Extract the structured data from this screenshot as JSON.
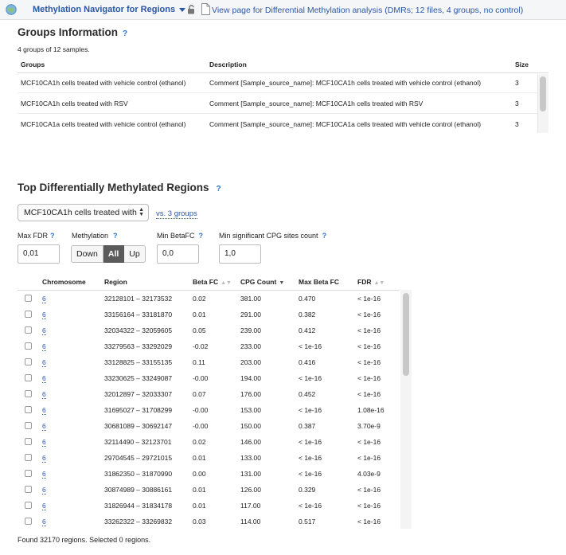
{
  "topbar": {
    "logo_icon": "globe-logo-icon",
    "app_title": "Methylation Navigator for Regions",
    "lock_icon": "lock-icon",
    "doc_icon": "document-icon",
    "view_link": "View page for Differential Methylation analysis (DMRs; 12 files, 4 groups, no control)"
  },
  "groups": {
    "title": "Groups Information",
    "help": "?",
    "count_text": "4 groups of 12 samples.",
    "columns": [
      "Groups",
      "Description",
      "Size"
    ],
    "rows": [
      {
        "group": "MCF10CA1h cells treated with vehicle control (ethanol)",
        "description": "Comment [Sample_source_name]: MCF10CA1h cells treated with vehicle control (ethanol)",
        "size": "3"
      },
      {
        "group": "MCF10CA1h cells treated with RSV",
        "description": "Comment [Sample_source_name]: MCF10CA1h cells treated with RSV",
        "size": "3"
      },
      {
        "group": "MCF10CA1a cells treated with vehicle control (ethanol)",
        "description": "Comment [Sample_source_name]: MCF10CA1a cells treated with vehicle control (ethanol)",
        "size": "3"
      }
    ]
  },
  "dmr": {
    "title": "Top Differentially Methylated Regions",
    "help": "?",
    "group_select": "MCF10CA1h cells treated with",
    "vs_link": "vs. 3 groups",
    "filters": {
      "max_fdr_label": "Max FDR",
      "max_fdr_value": "0,01",
      "methylation_label": "Methylation",
      "methylation_options": [
        "Down",
        "All",
        "Up"
      ],
      "methylation_selected": "All",
      "min_betafc_label": "Min BetaFC",
      "min_betafc_value": "0,0",
      "min_cpg_label": "Min significant CPG sites count",
      "min_cpg_value": "1,0"
    },
    "columns": [
      "Chromosome",
      "Region",
      "Beta FC",
      "CPG Count",
      "Max Beta FC",
      "FDR"
    ],
    "sorted_column": "CPG Count",
    "rows": [
      {
        "chrom": "6",
        "region": "32128101 – 32173532",
        "beta_fc": "0.02",
        "cpg": "381.00",
        "max_beta": "0.470",
        "fdr": "< 1e-16"
      },
      {
        "chrom": "6",
        "region": "33156164 – 33181870",
        "beta_fc": "0.01",
        "cpg": "291.00",
        "max_beta": "0.382",
        "fdr": "< 1e-16"
      },
      {
        "chrom": "6",
        "region": "32034322 – 32059605",
        "beta_fc": "0.05",
        "cpg": "239.00",
        "max_beta": "0.412",
        "fdr": "< 1e-16"
      },
      {
        "chrom": "6",
        "region": "33279563 – 33292029",
        "beta_fc": "-0.02",
        "cpg": "233.00",
        "max_beta": "< 1e-16",
        "fdr": "< 1e-16"
      },
      {
        "chrom": "6",
        "region": "33128825 – 33155135",
        "beta_fc": "0.11",
        "cpg": "203.00",
        "max_beta": "0.416",
        "fdr": "< 1e-16"
      },
      {
        "chrom": "6",
        "region": "33230625 – 33249087",
        "beta_fc": "-0.00",
        "cpg": "194.00",
        "max_beta": "< 1e-16",
        "fdr": "< 1e-16"
      },
      {
        "chrom": "6",
        "region": "32012897 – 32033307",
        "beta_fc": "0.07",
        "cpg": "176.00",
        "max_beta": "0.452",
        "fdr": "< 1e-16"
      },
      {
        "chrom": "6",
        "region": "31695027 – 31708299",
        "beta_fc": "-0.00",
        "cpg": "153.00",
        "max_beta": "< 1e-16",
        "fdr": "1.08e-16"
      },
      {
        "chrom": "6",
        "region": "30681089 – 30692147",
        "beta_fc": "-0.00",
        "cpg": "150.00",
        "max_beta": "0.387",
        "fdr": "3.70e-9"
      },
      {
        "chrom": "6",
        "region": "32114490 – 32123701",
        "beta_fc": "0.02",
        "cpg": "146.00",
        "max_beta": "< 1e-16",
        "fdr": "< 1e-16"
      },
      {
        "chrom": "6",
        "region": "29704545 – 29721015",
        "beta_fc": "0.01",
        "cpg": "133.00",
        "max_beta": "< 1e-16",
        "fdr": "< 1e-16"
      },
      {
        "chrom": "6",
        "region": "31862350 – 31870990",
        "beta_fc": "0.00",
        "cpg": "131.00",
        "max_beta": "< 1e-16",
        "fdr": "4.03e-9"
      },
      {
        "chrom": "6",
        "region": "30874989 – 30886161",
        "beta_fc": "0.01",
        "cpg": "126.00",
        "max_beta": "0.329",
        "fdr": "< 1e-16"
      },
      {
        "chrom": "6",
        "region": "31826944 – 31834178",
        "beta_fc": "0.01",
        "cpg": "117.00",
        "max_beta": "< 1e-16",
        "fdr": "< 1e-16"
      },
      {
        "chrom": "6",
        "region": "33262322 – 33269832",
        "beta_fc": "0.03",
        "cpg": "114.00",
        "max_beta": "0.517",
        "fdr": "< 1e-16"
      }
    ],
    "footer": "Found 32170 regions. Selected 0 regions."
  }
}
